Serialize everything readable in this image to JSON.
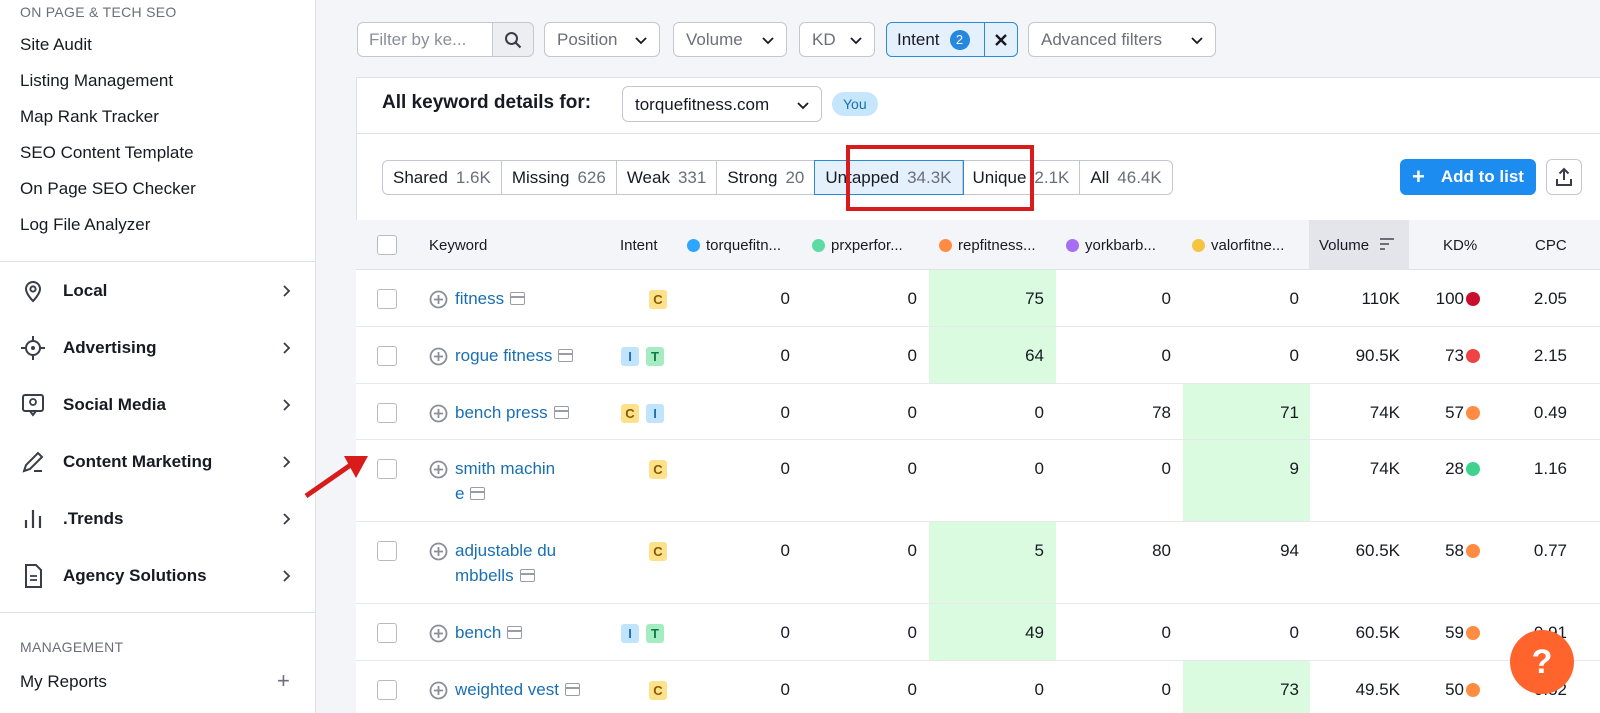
{
  "sidebar": {
    "section_onpage": "ON PAGE & TECH SEO",
    "onpage_items": [
      "Site Audit",
      "Listing Management",
      "Map Rank Tracker",
      "SEO Content Template",
      "On Page SEO Checker",
      "Log File Analyzer"
    ],
    "groups": [
      {
        "label": "Local",
        "icon": "location-pin-icon"
      },
      {
        "label": "Advertising",
        "icon": "target-icon"
      },
      {
        "label": "Social Media",
        "icon": "chat-bubble-icon"
      },
      {
        "label": "Content Marketing",
        "icon": "pencil-icon"
      },
      {
        "label": ".Trends",
        "icon": "bar-chart-icon"
      },
      {
        "label": "Agency Solutions",
        "icon": "document-icon"
      }
    ],
    "section_management": "MANAGEMENT",
    "my_reports": "My Reports"
  },
  "filters": {
    "search_placeholder": "Filter by ke...",
    "position": "Position",
    "volume": "Volume",
    "kd": "KD",
    "intent": "Intent",
    "intent_count": "2",
    "advanced": "Advanced filters"
  },
  "details": {
    "label": "All keyword details for:",
    "domain": "torquefitness.com",
    "you_badge": "You"
  },
  "tabs": [
    {
      "label": "Shared",
      "count": "1.6K"
    },
    {
      "label": "Missing",
      "count": "626"
    },
    {
      "label": "Weak",
      "count": "331"
    },
    {
      "label": "Strong",
      "count": "20"
    },
    {
      "label": "Untapped",
      "count": "34.3K"
    },
    {
      "label": "Unique",
      "count": "2.1K"
    },
    {
      "label": "All",
      "count": "46.4K"
    }
  ],
  "add_to_list": "Add to list",
  "columns": {
    "keyword": "Keyword",
    "intent": "Intent",
    "d1": "torquefitn...",
    "d2": "prxperfor...",
    "d3": "repfitness...",
    "d4": "yorkbarb...",
    "d5": "valorfitne...",
    "volume": "Volume",
    "kd": "KD%",
    "cpc": "CPC"
  },
  "colors": {
    "d1": "#2ea6ff",
    "d2": "#5cdba5",
    "d3": "#ff8c42",
    "d4": "#a66ef2",
    "d5": "#f5c542",
    "kd_very_hard": "#c8102e",
    "kd_hard": "#ef4444",
    "kd_difficult": "#ff8c42",
    "kd_easy": "#3fd28f"
  },
  "rows": [
    {
      "kw1": "fitness",
      "kw2": "",
      "intents": [
        "C"
      ],
      "d1": "0",
      "d2": "0",
      "d3": "75",
      "d4": "0",
      "d5": "0",
      "volume": "110K",
      "kd": "100",
      "cpc": "2.05"
    },
    {
      "kw1": "rogue fitness",
      "kw2": "",
      "intents": [
        "I",
        "T"
      ],
      "d1": "0",
      "d2": "0",
      "d3": "64",
      "d4": "0",
      "d5": "0",
      "volume": "90.5K",
      "kd": "73",
      "cpc": "2.15"
    },
    {
      "kw1": "bench press",
      "kw2": "",
      "intents": [
        "C",
        "I"
      ],
      "d1": "0",
      "d2": "0",
      "d3": "0",
      "d4": "78",
      "d5": "71",
      "volume": "74K",
      "kd": "57",
      "cpc": "0.49"
    },
    {
      "kw1": "smith machin",
      "kw2": "e",
      "intents": [
        "C"
      ],
      "d1": "0",
      "d2": "0",
      "d3": "0",
      "d4": "0",
      "d5": "9",
      "volume": "74K",
      "kd": "28",
      "cpc": "1.16"
    },
    {
      "kw1": "adjustable du",
      "kw2": "mbbells",
      "intents": [
        "C"
      ],
      "d1": "0",
      "d2": "0",
      "d3": "5",
      "d4": "80",
      "d5": "94",
      "volume": "60.5K",
      "kd": "58",
      "cpc": "0.77"
    },
    {
      "kw1": "bench",
      "kw2": "",
      "intents": [
        "I",
        "T"
      ],
      "d1": "0",
      "d2": "0",
      "d3": "49",
      "d4": "0",
      "d5": "0",
      "volume": "60.5K",
      "kd": "59",
      "cpc": "0.91"
    },
    {
      "kw1": "weighted vest",
      "kw2": "",
      "intents": [
        "C"
      ],
      "d1": "0",
      "d2": "0",
      "d3": "0",
      "d4": "0",
      "d5": "73",
      "volume": "49.5K",
      "kd": "50",
      "cpc": "0.52"
    }
  ],
  "help": "?"
}
